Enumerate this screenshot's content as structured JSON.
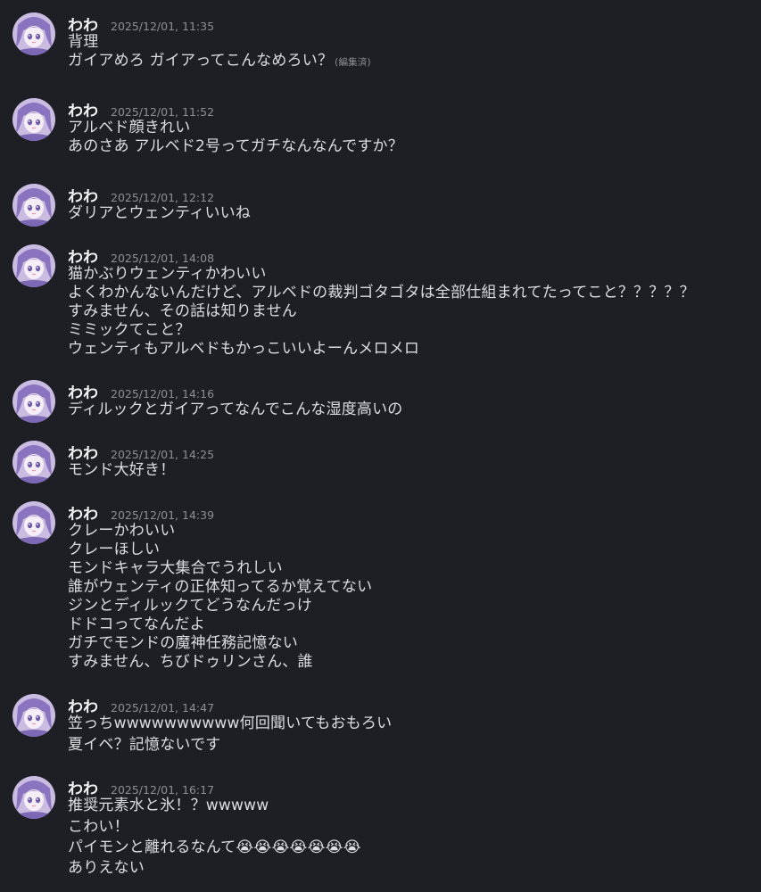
{
  "groups": [
    {
      "username": "わわ",
      "timestamp": "2025/12/01, 11:35",
      "lines": [
        {
          "text": "背理",
          "edited": ""
        },
        {
          "text": "ガイアめろ ガイアってこんなめろい？",
          "edited": "(編集済)"
        }
      ]
    },
    {
      "username": "わわ",
      "timestamp": "2025/12/01, 11:52",
      "lines": [
        {
          "text": "アルベド顔きれい",
          "edited": ""
        },
        {
          "text": "あのさあ アルベド2号ってガチなんなんですか？",
          "edited": ""
        }
      ]
    },
    {
      "username": "わわ",
      "timestamp": "2025/12/01, 12:12",
      "lines": [
        {
          "text": "ダリアとウェンティいいね",
          "edited": ""
        }
      ]
    },
    {
      "username": "わわ",
      "timestamp": "2025/12/01, 14:08",
      "lines": [
        {
          "text": "猫かぶりウェンティかわいい",
          "edited": ""
        },
        {
          "text": "よくわかんないんだけど、アルベドの裁判ゴタゴタは全部仕組まれてたってこと？？？？？",
          "edited": ""
        },
        {
          "text": "すみません、その話は知りません",
          "edited": ""
        },
        {
          "text": "ミミックてこと？",
          "edited": ""
        },
        {
          "text": "ウェンティもアルベドもかっこいいよーんメロメロ",
          "edited": ""
        }
      ]
    },
    {
      "username": "わわ",
      "timestamp": "2025/12/01, 14:16",
      "lines": [
        {
          "text": "ディルックとガイアってなんでこんな湿度高いの",
          "edited": ""
        }
      ]
    },
    {
      "username": "わわ",
      "timestamp": "2025/12/01, 14:25",
      "lines": [
        {
          "text": "モンド大好き！",
          "edited": ""
        }
      ]
    },
    {
      "username": "わわ",
      "timestamp": "2025/12/01, 14:39",
      "lines": [
        {
          "text": "クレーかわいい",
          "edited": ""
        },
        {
          "text": "クレーほしい",
          "edited": ""
        },
        {
          "text": "モンドキャラ大集合でうれしい",
          "edited": ""
        },
        {
          "text": "誰がウェンティの正体知ってるか覚えてない",
          "edited": ""
        },
        {
          "text": "ジンとディルックてどうなんだっけ",
          "edited": ""
        },
        {
          "text": "ドドコってなんだよ",
          "edited": ""
        },
        {
          "text": "ガチでモンドの魔神任務記憶ない",
          "edited": ""
        },
        {
          "text": "すみません、ちびドゥリンさん、誰",
          "edited": ""
        }
      ]
    },
    {
      "username": "わわ",
      "timestamp": "2025/12/01, 14:47",
      "lines": [
        {
          "text": "笠っちwwwwwwwwww何回聞いてもおもろい",
          "edited": ""
        },
        {
          "text": "夏イベ？記憶ないです",
          "edited": ""
        }
      ]
    },
    {
      "username": "わわ",
      "timestamp": "2025/12/01, 16:17",
      "lines": [
        {
          "text": "推奨元素水と氷！？wwwww",
          "edited": ""
        },
        {
          "text": "こわい！",
          "edited": ""
        },
        {
          "text": "パイモンと離れるなんて😭😭😭😭😭😭😭",
          "edited": ""
        },
        {
          "text": "ありえない",
          "edited": ""
        }
      ]
    }
  ]
}
